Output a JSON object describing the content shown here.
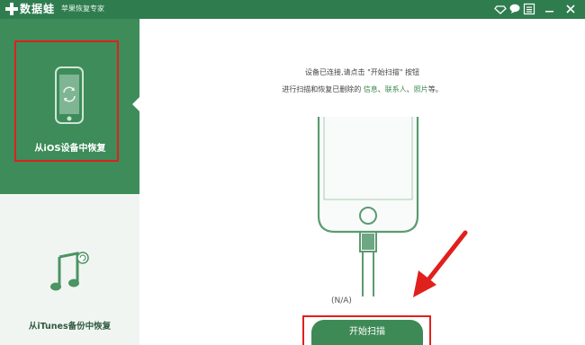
{
  "app": {
    "name": "数据蛙",
    "subtitle": "苹果恢复专家"
  },
  "sidebar": {
    "items": [
      {
        "label": "从iOS设备中恢复",
        "icon": "phone-refresh-icon"
      },
      {
        "label": "从iTunes备份中恢复",
        "icon": "music-note-icon"
      }
    ]
  },
  "main": {
    "line1": "设备已连接,请点击 \"开始扫描\" 按钮",
    "line2_prefix": "进行扫描和恢复已删除的",
    "line2_links": [
      "信息",
      "联系人",
      "照片"
    ],
    "line2_sep": "、",
    "line2_suffix": "等。",
    "status": "(N/A)",
    "start_button": "开始扫描"
  },
  "colors": {
    "brand_green": "#2f7d4f",
    "sidebar_active": "#3d8c5a",
    "highlight_red": "#e0201c"
  }
}
